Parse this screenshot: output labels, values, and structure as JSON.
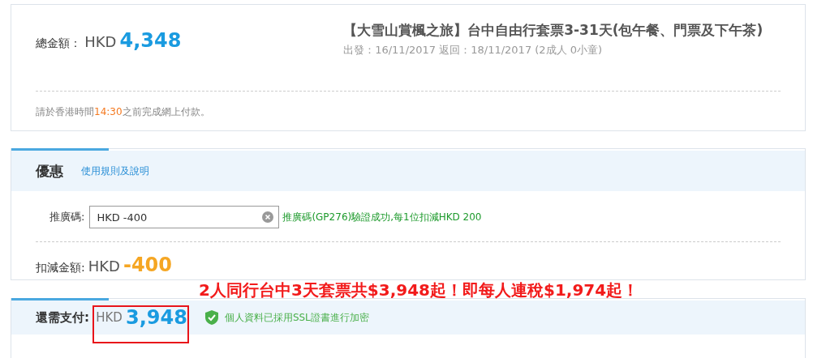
{
  "summary": {
    "total_label": "總金額：",
    "total_currency": "HKD",
    "total_amount": "4,348",
    "title": "【大雪山賞楓之旅】台中自由行套票3-31天(包午餐、門票及下午茶)",
    "dates": "出發：16/11/2017 返回：18/11/2017 (2成人 0小童)",
    "deadline_before": "請於香港時間",
    "deadline_time": "14:30",
    "deadline_after": "之前完成網上付款。"
  },
  "discount": {
    "heading": "優惠",
    "rules_link": "使用規則及說明",
    "code_label": "推廣碼:",
    "code_value": "HKD -400",
    "code_message": "推廣碼(GP276)驗證成功,每1位扣減HKD 200",
    "deduct_label": "扣減金額:",
    "deduct_currency": "HKD",
    "deduct_amount": "-400"
  },
  "payment": {
    "label": "還需支付:",
    "currency": "HKD",
    "amount": "3,948",
    "security_note": "個人資料已採用SSL證書進行加密"
  },
  "annotation": {
    "text": "2人同行台中3天套票共$3,948起！即每人連稅$1,974起！"
  }
}
